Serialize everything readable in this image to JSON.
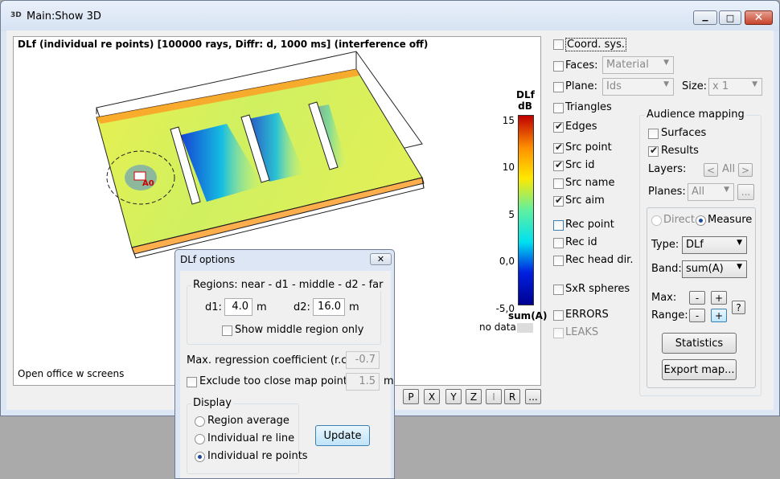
{
  "window": {
    "title": "Main:Show 3D",
    "icon": "3D",
    "min_glyph": "▁",
    "max_glyph": "□",
    "close_glyph": "✕"
  },
  "canvas": {
    "title": "DLf (individual re points) [100000 rays, Diffr: d, 1000 ms] (interference off)",
    "model_name": "Open office w screens",
    "source_label": "A0"
  },
  "colorbar": {
    "title_line1": "DLf",
    "title_line2": "dB",
    "ticks": [
      "15",
      "10",
      "5",
      "0,0",
      "-5,0"
    ],
    "unit": "sum(A)",
    "no_data_label": "no data:",
    "colors": [
      "#c00000",
      "#ff9000",
      "#ffe800",
      "#60f0a0",
      "#00e0f0",
      "#0020e0",
      "#000090"
    ]
  },
  "view_buttons": [
    "P",
    "X",
    "Y",
    "Z",
    "I",
    "R",
    "..."
  ],
  "options": {
    "coord_sys": "Coord. sys.",
    "faces": "Faces:",
    "faces_value": "Material",
    "plane": "Plane:",
    "plane_value": "Ids",
    "size": "Size:",
    "size_value": "x 1",
    "triangles": "Triangles",
    "edges": "Edges",
    "src_point": "Src point",
    "src_id": "Src id",
    "src_name": "Src name",
    "src_aim": "Src aim",
    "rec_point": "Rec point",
    "rec_id": "Rec id",
    "rec_head_dir": "Rec head dir.",
    "sxr_spheres": "SxR spheres",
    "errors": "ERRORS",
    "leaks": "LEAKS"
  },
  "audience": {
    "title": "Audience mapping",
    "surfaces": "Surfaces",
    "results": "Results",
    "layers_label": "Layers:",
    "layers_prev": "<",
    "layers_value": "All",
    "layers_next": ">",
    "planes_label": "Planes:",
    "planes_value": "All",
    "planes_more": "...",
    "direct": "Direct",
    "measure": "Measure",
    "type_label": "Type:",
    "type_value": "DLf",
    "band_label": "Band:",
    "band_value": "sum(A)",
    "max_label": "Max:",
    "range_label": "Range:",
    "minus": "-",
    "plus": "+",
    "help": "?",
    "statistics": "Statistics",
    "export_map": "Export map..."
  },
  "dialog": {
    "title": "DLf options",
    "close_glyph": "✕",
    "regions_title": "Regions: near - d1 - middle - d2 - far",
    "d1_label": "d1:",
    "d1_value": "4.0",
    "d1_unit": "m",
    "d2_label": "d2:",
    "d2_value": "16.0",
    "d2_unit": "m",
    "show_middle": "Show middle region only",
    "max_reg_label": "Max. regression coefficient (r.c.):",
    "max_reg_value": "-0.7",
    "exclude_label": "Exclude too close map points:",
    "exclude_value": "1.5",
    "exclude_unit": "m",
    "display_title": "Display",
    "region_average": "Region average",
    "individual_line": "Individual re line",
    "individual_points": "Individual re points",
    "update": "Update"
  }
}
